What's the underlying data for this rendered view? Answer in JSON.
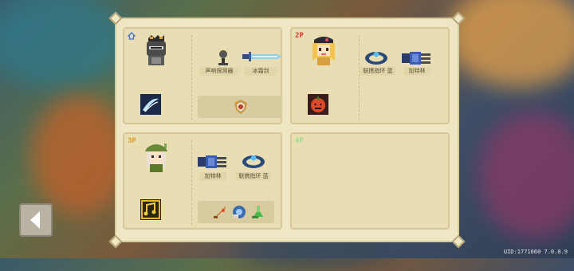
{
  "players": [
    {
      "badge": "",
      "badge_icon": "home-icon",
      "character": "knight",
      "skill_icon": "ice-slash-skill-icon",
      "weapons": [
        {
          "name": "声响探测器",
          "icon": "sound-detector-icon"
        },
        {
          "name": "冰霜剑",
          "icon": "frost-sword-icon"
        }
      ],
      "buffs": [
        "shield-buff-icon"
      ]
    },
    {
      "badge": "2P",
      "badge_color": "#d9392b",
      "character": "blonde-girl",
      "skill_icon": "pumpkin-skill-icon",
      "weapons": [
        {
          "name": "联携指环 蓝",
          "icon": "blue-ring-icon"
        },
        {
          "name": "加特林",
          "icon": "gatling-gun-icon"
        }
      ],
      "buffs": []
    },
    {
      "badge": "3P",
      "badge_color": "#e0a020",
      "character": "elf",
      "skill_icon": "music-skill-icon",
      "weapons": [
        {
          "name": "加特林",
          "icon": "gatling-gun-icon"
        },
        {
          "name": "联携指环 蓝",
          "icon": "blue-ring-icon"
        }
      ],
      "buffs": [
        "sword-buff-icon",
        "shield-gear-buff-icon",
        "green-arrow-buff-icon"
      ]
    },
    {
      "badge": "4P",
      "badge_color": "#9fd98a"
    }
  ],
  "back_button_icon": "back-arrow-icon",
  "footer": {
    "uid": "UID:1771660 7.0.0.9"
  }
}
